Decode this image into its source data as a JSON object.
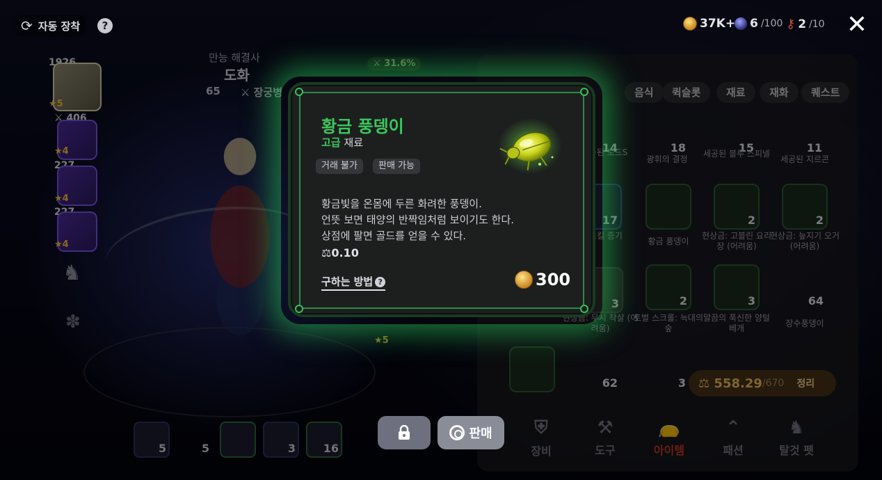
{
  "topbar": {
    "auto_equip_label": "자동 장착",
    "help_symbol": "?",
    "gold": "37K+",
    "energy": "6",
    "energy_max": "/100",
    "keys": "2",
    "keys_max": "/10",
    "close_symbol": "✕"
  },
  "character": {
    "title": "만능 해결사",
    "name": "도화",
    "level": "65",
    "class": "장궁병",
    "weapon_power": "1926",
    "slots": [
      {
        "power": "406",
        "stars": "★4"
      },
      {
        "power": "227",
        "stars": "★4"
      },
      {
        "power": "227",
        "stars": "★4"
      }
    ],
    "main_stars": "★5",
    "side_stars": "★5",
    "percent_badge": "31.6%"
  },
  "quickslots": [
    "5",
    "5",
    "",
    "3",
    "16"
  ],
  "inventory": {
    "tabs": [
      "음식",
      "퀵슬롯",
      "재료",
      "재화",
      "퀘스트"
    ],
    "items": [
      {
        "count": "14",
        "name": "세공된 토드S"
      },
      {
        "count": "18",
        "name": "광휘의 결정"
      },
      {
        "count": "15",
        "name": "세공된 블루 스피넬"
      },
      {
        "count": "11",
        "name": "세공된 지르콘"
      },
      {
        "count": "17",
        "name": "스킬 증기"
      },
      {
        "count": "",
        "name": "황금 풍뎅이"
      },
      {
        "count": "2",
        "name": "현상금: 고블린 요리장 (어려움)"
      },
      {
        "count": "2",
        "name": "현상금: 늪지기 오거 (어려움)"
      },
      {
        "count": "3",
        "name": "현상금: 무시 작살 (어려움)"
      },
      {
        "count": "2",
        "name": "토벌 스크롤: 늑대의 숲"
      },
      {
        "count": "3",
        "name": "말끔의 푹신한 양털 베개"
      },
      {
        "count": "64",
        "name": "장수풍뎅이"
      },
      {
        "count": "62",
        "name": ""
      },
      {
        "count": "3",
        "name": ""
      }
    ],
    "weight_current": "558.29",
    "weight_max": "/670",
    "sort_label": "정리"
  },
  "nav": [
    {
      "label": "장비",
      "icon": "shield-icon"
    },
    {
      "label": "도구",
      "icon": "axe-icon"
    },
    {
      "label": "아이템",
      "icon": "bag-icon"
    },
    {
      "label": "패션",
      "icon": "hanger-icon"
    },
    {
      "label": "탈것 펫",
      "icon": "horse-icon"
    }
  ],
  "popup": {
    "item_name": "황금 풍뎅이",
    "grade": "고급",
    "item_type": "재료",
    "tags": [
      "거래 불가",
      "판매 가능"
    ],
    "description": [
      "황금빛을 온몸에 두른 화려한 풍뎅이.",
      "언뜻 보면 태양의 반짝임처럼 보이기도 한다.",
      "상점에 팔면 골드를 얻을 수 있다."
    ],
    "weight": "0.10",
    "how_to_obtain": "구하는 방법",
    "price": "300",
    "colors": {
      "grade": "#3cc85e",
      "glow": "#28c85a"
    }
  },
  "actions": {
    "sell_label": "판매"
  }
}
